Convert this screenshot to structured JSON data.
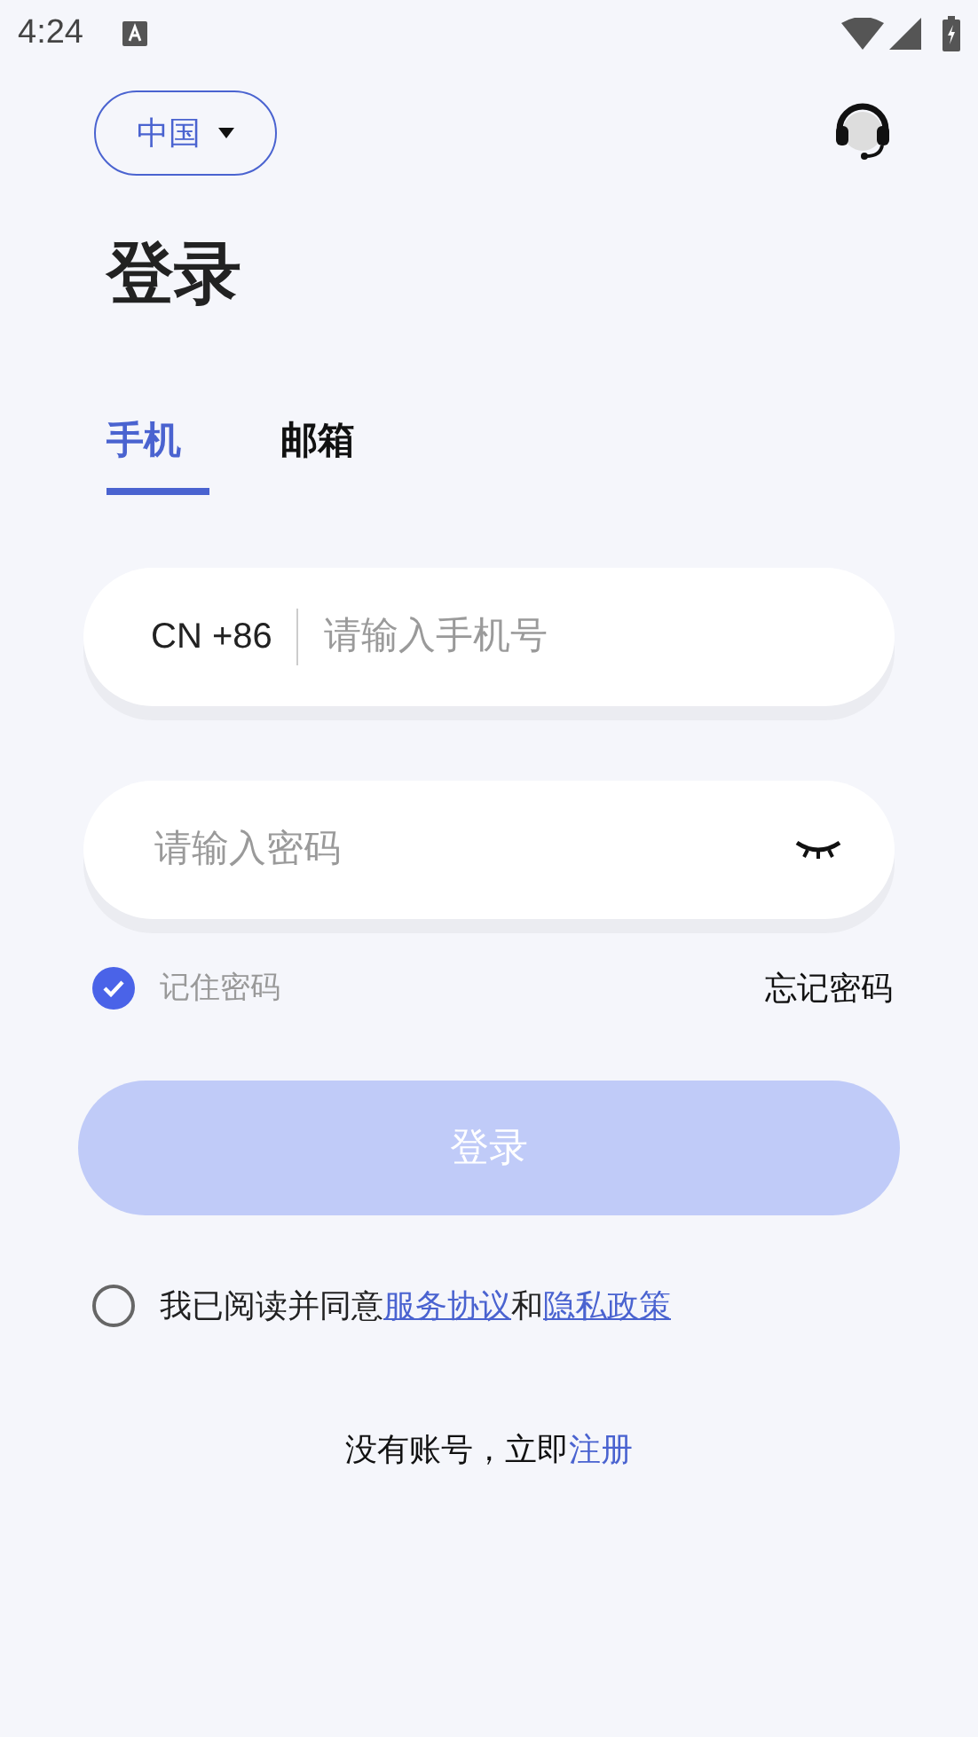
{
  "status_bar": {
    "time": "4:24"
  },
  "region_selector": {
    "label": "中国"
  },
  "title": "登录",
  "tabs": [
    {
      "label": "手机",
      "selected": true
    },
    {
      "label": "邮箱",
      "selected": false
    }
  ],
  "phone_field": {
    "country_code": "CN +86",
    "placeholder": "请输入手机号"
  },
  "password_field": {
    "placeholder": "请输入密码",
    "visible": false
  },
  "remember": {
    "label": "记住密码",
    "checked": true
  },
  "forgot_link": "忘记密码",
  "login_button": {
    "label": "登录",
    "disabled": true
  },
  "agreement": {
    "checked": false,
    "text": "我已阅读并同意",
    "link_1": "服务协议",
    "conjunction": "和",
    "link_2": "隐私政策"
  },
  "register": {
    "text": "没有账号，立即",
    "link": "注册"
  }
}
